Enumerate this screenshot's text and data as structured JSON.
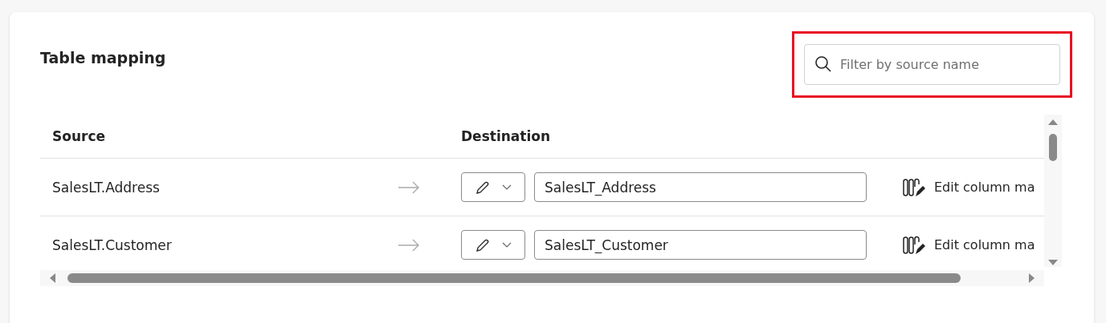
{
  "title": "Table mapping",
  "search": {
    "placeholder": "Filter by source name",
    "highlighted": true
  },
  "columns": [
    "Source",
    "Destination"
  ],
  "rows": [
    {
      "source": "SalesLT.Address",
      "destination": "SalesLT_Address",
      "action": "Edit column ma"
    },
    {
      "source": "SalesLT.Customer",
      "destination": "SalesLT_Customer",
      "action": "Edit column ma"
    }
  ]
}
